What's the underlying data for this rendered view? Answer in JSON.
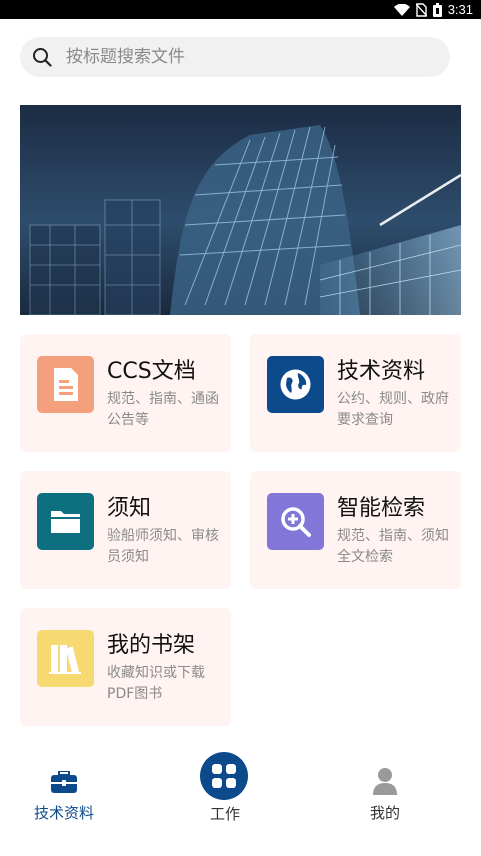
{
  "status_bar": {
    "time": "3:31",
    "icons": [
      "wifi-icon",
      "no-sim-icon",
      "battery-icon"
    ]
  },
  "search": {
    "placeholder": "按标题搜索文件",
    "icon": "search-icon"
  },
  "banner": {
    "image": "architecture-banner"
  },
  "cards": [
    {
      "title": "CCS文档",
      "description": "规范、指南、通函公告等",
      "icon": "document-icon",
      "icon_color": "#f4a07c"
    },
    {
      "title": "技术资料",
      "description": "公约、规则、政府要求查询",
      "icon": "globe-icon",
      "icon_color": "#0d4a8c"
    },
    {
      "title": "须知",
      "description": "验船师须知、审核员须知",
      "icon": "folder-icon",
      "icon_color": "#0e6f80"
    },
    {
      "title": "智能检索",
      "description": "规范、指南、须知全文检索",
      "icon": "search-plus-icon",
      "icon_color": "#8277d8"
    },
    {
      "title": "我的书架",
      "description": "收藏知识或下载PDF图书",
      "icon": "bookshelf-icon",
      "icon_color": "#f7d972"
    }
  ],
  "bottom_nav": {
    "items": [
      {
        "label": "技术资料",
        "icon": "briefcase-icon",
        "active": true
      },
      {
        "label": "工作",
        "icon": "grid-icon",
        "active": false
      },
      {
        "label": "我的",
        "icon": "user-icon",
        "active": false
      }
    ]
  },
  "colors": {
    "accent": "#0d4a8c",
    "card_bg": "#fff4f2",
    "muted_text": "#8a8a8a"
  }
}
